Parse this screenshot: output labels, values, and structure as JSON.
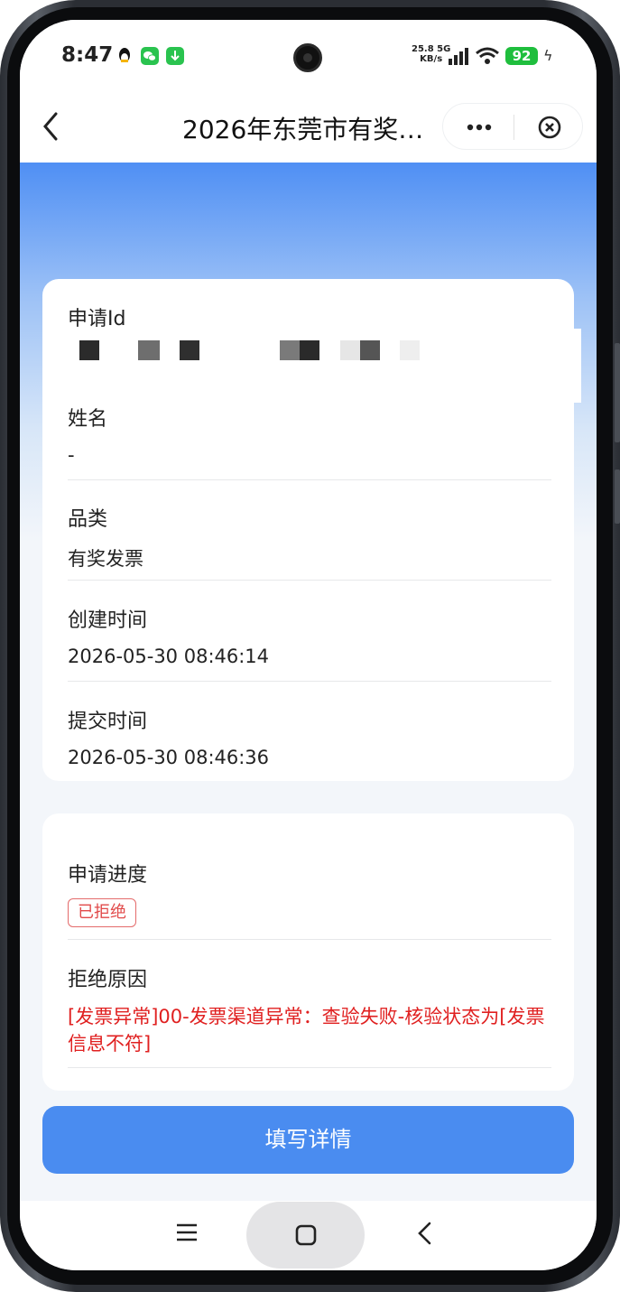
{
  "status_bar": {
    "time": "8:47",
    "net_speed": "25.8",
    "net_unit": "KB/s",
    "net_type": "5G",
    "battery": "92"
  },
  "nav": {
    "title": "2026年东莞市有奖…"
  },
  "details": {
    "application_id_label": "申请Id",
    "name_label": "姓名",
    "name_value": "-",
    "category_label": "品类",
    "category_value": "有奖发票",
    "created_label": "创建时间",
    "created_value": "2026-05-30 08:46:14",
    "submitted_label": "提交时间",
    "submitted_value": "2026-05-30 08:46:36"
  },
  "progress": {
    "status_label": "申请进度",
    "status_badge": "已拒绝",
    "reason_label": "拒绝原因",
    "reason_value": "[发票异常]00-发票渠道异常：查验失败-核验状态为[发票信息不符]"
  },
  "actions": {
    "fill_details": "填写详情"
  },
  "colors": {
    "primary": "#4a8cf0",
    "danger": "#e02020",
    "battery": "#1fbe3d"
  }
}
